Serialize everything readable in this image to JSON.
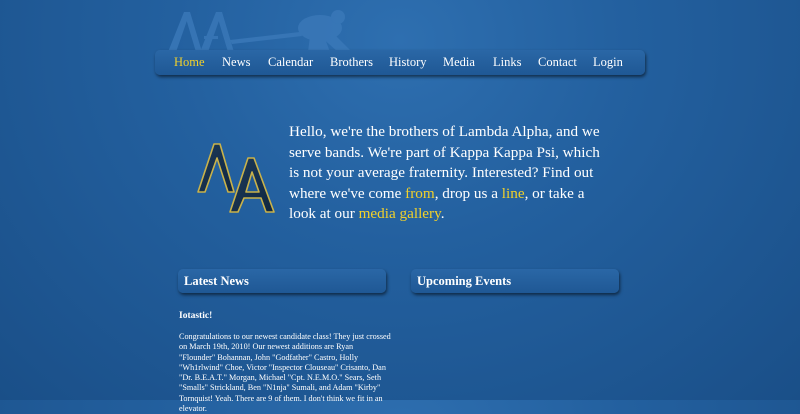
{
  "header": {
    "logo_icon": "lambda-alpha-header-logo"
  },
  "nav": {
    "items": [
      {
        "label": "Home",
        "active": true
      },
      {
        "label": "News",
        "active": false
      },
      {
        "label": "Calendar",
        "active": false
      },
      {
        "label": "Brothers",
        "active": false
      },
      {
        "label": "History",
        "active": false
      },
      {
        "label": "Media",
        "active": false
      },
      {
        "label": "Links",
        "active": false
      },
      {
        "label": "Contact",
        "active": false
      },
      {
        "label": "Login",
        "active": false
      }
    ]
  },
  "intro": {
    "logo_icon": "lambda-alpha-crest-logo",
    "text_1": "Hello, we're the brothers of Lambda Alpha, and we serve bands. We're part of Kappa Kappa Psi, which is not your average fraternity. Interested? Find out where we've come ",
    "link_from": "from",
    "text_2": ", drop us a ",
    "link_line": "line",
    "text_3": ", or take a look at our ",
    "link_media": "media gallery",
    "text_4": "."
  },
  "news": {
    "heading": "Latest News",
    "post_title": "Iotastic!",
    "post_body": "Congratulations to our newest candidate class! They just crossed on March 19th, 2010! Our newest additions are Ryan \"Flounder\" Bohannan, John \"Godfather\" Castro, Holly \"Wh1rlwind\" Choe, Victor \"Inspector Clouseau\" Crisanto, Dan \"Dr. B.E.A.T.\" Morgan, Michael \"Cpt. N.E.M.O.\" Sears, Seth \"Smalls\" Strickland, Ben \"N1nja\" Sumali, and Adam \"Kirby\" Tornquist! Yeah. There are 9 of them. I don't think we fit in an elevator."
  },
  "events": {
    "heading": "Upcoming Events"
  },
  "colors": {
    "background": "#23609f",
    "nav_bar": "#1f5895",
    "active_link": "#f2d12a",
    "text": "#ffffff"
  }
}
